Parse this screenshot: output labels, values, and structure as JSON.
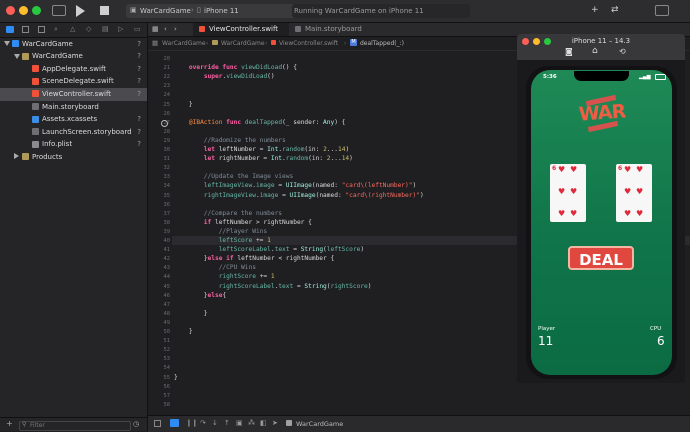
{
  "titlebar": {
    "scheme": "WarCardGame",
    "device": "iPhone 11",
    "status": "Running WarCardGame on iPhone 11"
  },
  "tabs": [
    {
      "label": "ViewController.swift"
    },
    {
      "label": "Main.storyboard"
    }
  ],
  "breadcrumbs": [
    "WarCardGame",
    "WarCardGame",
    "ViewController.swift",
    "M",
    "dealTapped(_:)"
  ],
  "navigator": {
    "items": [
      {
        "label": "WarCardGame",
        "flag": "?",
        "level": 0,
        "kind": "project"
      },
      {
        "label": "WarCardGame",
        "flag": "?",
        "level": 1,
        "kind": "folder"
      },
      {
        "label": "AppDelegate.swift",
        "flag": "?",
        "level": 2,
        "kind": "swift"
      },
      {
        "label": "SceneDelegate.swift",
        "flag": "?",
        "level": 2,
        "kind": "swift"
      },
      {
        "label": "ViewController.swift",
        "flag": "?",
        "level": 2,
        "kind": "swift",
        "selected": true
      },
      {
        "label": "Main.storyboard",
        "flag": "",
        "level": 2,
        "kind": "storyboard"
      },
      {
        "label": "Assets.xcassets",
        "flag": "?",
        "level": 2,
        "kind": "assets"
      },
      {
        "label": "LaunchScreen.storyboard",
        "flag": "?",
        "level": 2,
        "kind": "storyboard"
      },
      {
        "label": "Info.plist",
        "flag": "?",
        "level": 2,
        "kind": "plist"
      },
      {
        "label": "Products",
        "flag": "",
        "level": 1,
        "kind": "folder",
        "collapsed": true
      }
    ],
    "filter_placeholder": "Filter"
  },
  "code": {
    "current_line": "40",
    "lines": [
      {
        "n": "20",
        "segs": []
      },
      {
        "n": "21",
        "segs": [
          [
            "kw",
            "    override func "
          ],
          [
            "fn",
            "viewDidLoad"
          ],
          [
            "",
            "() {"
          ]
        ]
      },
      {
        "n": "22",
        "segs": [
          [
            "",
            "        "
          ],
          [
            "kw",
            "super"
          ],
          [
            "",
            "."
          ],
          [
            "fn",
            "viewDidLoad"
          ],
          [
            "",
            "()"
          ]
        ]
      },
      {
        "n": "23",
        "segs": []
      },
      {
        "n": "24",
        "segs": []
      },
      {
        "n": "25",
        "segs": [
          [
            "",
            "    }"
          ]
        ]
      },
      {
        "n": "26",
        "segs": []
      },
      {
        "n": "27",
        "segs": [
          [
            "at",
            "    @IBAction "
          ],
          [
            "kw",
            "func "
          ],
          [
            "fn",
            "dealTapped"
          ],
          [
            "",
            "(_ sender: "
          ],
          [
            "ty",
            "Any"
          ],
          [
            "",
            ") {"
          ]
        ]
      },
      {
        "n": "28",
        "segs": []
      },
      {
        "n": "29",
        "segs": [
          [
            "cm",
            "        //Radomize the numbers"
          ]
        ]
      },
      {
        "n": "30",
        "segs": [
          [
            "kw",
            "        let "
          ],
          [
            "",
            "leftNumber = "
          ],
          [
            "ty",
            "Int"
          ],
          [
            "",
            "."
          ],
          [
            "fn",
            "random"
          ],
          [
            "",
            "(in: "
          ],
          [
            "nm",
            "2"
          ],
          [
            "",
            "..."
          ],
          [
            "nm",
            "14"
          ],
          [
            "",
            ")"
          ]
        ]
      },
      {
        "n": "31",
        "segs": [
          [
            "kw",
            "        let "
          ],
          [
            "",
            "rightNumber = "
          ],
          [
            "ty",
            "Int"
          ],
          [
            "",
            "."
          ],
          [
            "fn",
            "random"
          ],
          [
            "",
            "(in: "
          ],
          [
            "nm",
            "2"
          ],
          [
            "",
            "..."
          ],
          [
            "nm",
            "14"
          ],
          [
            "",
            ")"
          ]
        ]
      },
      {
        "n": "32",
        "segs": []
      },
      {
        "n": "33",
        "segs": [
          [
            "cm",
            "        //Update the Image views"
          ]
        ]
      },
      {
        "n": "34",
        "segs": [
          [
            "fn",
            "        leftImageView"
          ],
          [
            "",
            "."
          ],
          [
            "fn",
            "image"
          ],
          [
            "",
            " = "
          ],
          [
            "ty",
            "UIImage"
          ],
          [
            "",
            "(named: "
          ],
          [
            "st",
            "\"card\\(leftNumber)\""
          ],
          [
            "",
            ")"
          ]
        ]
      },
      {
        "n": "35",
        "segs": [
          [
            "fn",
            "        rightImageView"
          ],
          [
            "",
            "."
          ],
          [
            "fn",
            "image"
          ],
          [
            "",
            " = "
          ],
          [
            "ty",
            "UIImage"
          ],
          [
            "",
            "(named: "
          ],
          [
            "st",
            "\"card\\(rightNumber)\""
          ],
          [
            "",
            ")"
          ]
        ]
      },
      {
        "n": "36",
        "segs": []
      },
      {
        "n": "37",
        "segs": [
          [
            "cm",
            "        //Compare the numbers"
          ]
        ]
      },
      {
        "n": "38",
        "segs": [
          [
            "kw",
            "        if "
          ],
          [
            "",
            "leftNumber > rightNumber {"
          ]
        ]
      },
      {
        "n": "39",
        "segs": [
          [
            "cm",
            "            //Player Wins"
          ]
        ]
      },
      {
        "n": "40",
        "segs": [
          [
            "fn",
            "            leftScore"
          ],
          [
            "",
            " += "
          ],
          [
            "nm",
            "1"
          ]
        ]
      },
      {
        "n": "41",
        "segs": [
          [
            "fn",
            "            leftScoreLabel"
          ],
          [
            "",
            "."
          ],
          [
            "fn",
            "text"
          ],
          [
            "",
            " = "
          ],
          [
            "ty",
            "String"
          ],
          [
            "",
            "("
          ],
          [
            "fn",
            "leftScore"
          ],
          [
            "",
            ")"
          ]
        ]
      },
      {
        "n": "42",
        "segs": [
          [
            "",
            "        }"
          ],
          [
            "kw",
            "else if "
          ],
          [
            "",
            "leftNumber < rightNumber {"
          ]
        ]
      },
      {
        "n": "43",
        "segs": [
          [
            "cm",
            "            //CPU Wins"
          ]
        ]
      },
      {
        "n": "44",
        "segs": [
          [
            "fn",
            "            rightScore"
          ],
          [
            "",
            " += "
          ],
          [
            "nm",
            "1"
          ]
        ]
      },
      {
        "n": "45",
        "segs": [
          [
            "fn",
            "            rightScoreLabel"
          ],
          [
            "",
            "."
          ],
          [
            "fn",
            "text"
          ],
          [
            "",
            " = "
          ],
          [
            "ty",
            "String"
          ],
          [
            "",
            "("
          ],
          [
            "fn",
            "rightScore"
          ],
          [
            "",
            ")"
          ]
        ]
      },
      {
        "n": "46",
        "segs": [
          [
            "",
            "        }"
          ],
          [
            "kw",
            "else"
          ],
          [
            "",
            "{"
          ]
        ]
      },
      {
        "n": "47",
        "segs": []
      },
      {
        "n": "48",
        "segs": [
          [
            "",
            "        }"
          ]
        ]
      },
      {
        "n": "49",
        "segs": []
      },
      {
        "n": "50",
        "segs": [
          [
            "",
            "    }"
          ]
        ]
      },
      {
        "n": "51",
        "segs": []
      },
      {
        "n": "52",
        "segs": []
      },
      {
        "n": "53",
        "segs": []
      },
      {
        "n": "54",
        "segs": []
      },
      {
        "n": "55",
        "segs": [
          [
            "",
            "}"
          ]
        ]
      },
      {
        "n": "56",
        "segs": []
      },
      {
        "n": "57",
        "segs": []
      },
      {
        "n": "58",
        "segs": []
      }
    ]
  },
  "debug": {
    "target": "WarCardGame"
  },
  "simulator": {
    "title": "iPhone 11 – 14.3",
    "time": "5:36",
    "logo": "WAR",
    "left_card": {
      "value": "6",
      "suit": "♥"
    },
    "right_card": {
      "value": "6",
      "suit": "♥"
    },
    "deal_label": "DEAL",
    "player_label": "Player",
    "player_score": "11",
    "cpu_label": "CPU",
    "cpu_score": "6"
  },
  "colors": {
    "accent": "#2f8cf5",
    "table_green": "#117a4c",
    "deal_red": "#e0483f",
    "suit_red": "#e0293a"
  }
}
